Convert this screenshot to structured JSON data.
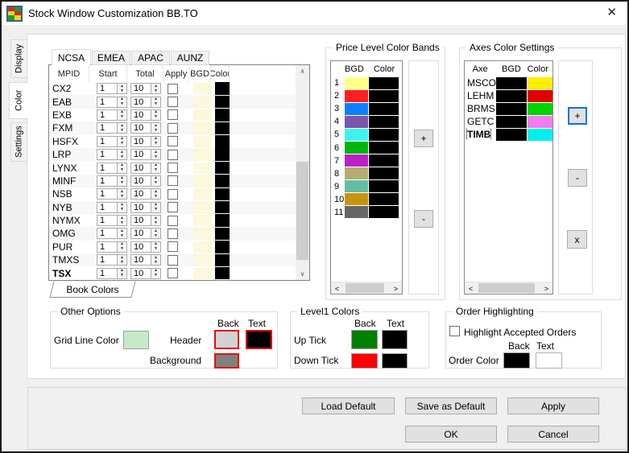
{
  "window": {
    "title": "Stock Window Customization BB.TO",
    "close_glyph": "✕"
  },
  "side_tabs": [
    {
      "label": "Display"
    },
    {
      "label": "Color"
    },
    {
      "label": "Settings"
    }
  ],
  "region_tabs": [
    {
      "label": "NCSA"
    },
    {
      "label": "EMEA"
    },
    {
      "label": "APAC"
    },
    {
      "label": "AUNZ"
    }
  ],
  "book_table": {
    "headers": {
      "mpid": "MPID",
      "start": "Start",
      "total": "Total",
      "apply": "Apply",
      "bgd": "BGD",
      "color": "Color"
    },
    "rows": [
      {
        "mpid": "CX2",
        "start": "1",
        "total": "10",
        "bgd": "#FBF8DC",
        "color": "#000000"
      },
      {
        "mpid": "EAB",
        "start": "1",
        "total": "10",
        "bgd": "#FBF8DC",
        "color": "#000000"
      },
      {
        "mpid": "EXB",
        "start": "1",
        "total": "10",
        "bgd": "#FBF8DC",
        "color": "#000000"
      },
      {
        "mpid": "FXM",
        "start": "1",
        "total": "10",
        "bgd": "#FBF8DC",
        "color": "#000000"
      },
      {
        "mpid": "HSFX",
        "start": "1",
        "total": "10",
        "bgd": "#FBF8DC",
        "color": "#000000"
      },
      {
        "mpid": "LRP",
        "start": "1",
        "total": "10",
        "bgd": "#FBF8DC",
        "color": "#000000"
      },
      {
        "mpid": "LYNX",
        "start": "1",
        "total": "10",
        "bgd": "#FBF8DC",
        "color": "#000000"
      },
      {
        "mpid": "MINF",
        "start": "1",
        "total": "10",
        "bgd": "#FBF8DC",
        "color": "#000000"
      },
      {
        "mpid": "NSB",
        "start": "1",
        "total": "10",
        "bgd": "#FBF8DC",
        "color": "#000000"
      },
      {
        "mpid": "NYB",
        "start": "1",
        "total": "10",
        "bgd": "#FBF8DC",
        "color": "#000000"
      },
      {
        "mpid": "NYMX",
        "start": "1",
        "total": "10",
        "bgd": "#FBF8DC",
        "color": "#000000"
      },
      {
        "mpid": "OMG",
        "start": "1",
        "total": "10",
        "bgd": "#FBF8DC",
        "color": "#000000"
      },
      {
        "mpid": "PUR",
        "start": "1",
        "total": "10",
        "bgd": "#FBF8DC",
        "color": "#000000"
      },
      {
        "mpid": "TMXS",
        "start": "1",
        "total": "10",
        "bgd": "#FBF8DC",
        "color": "#000000"
      },
      {
        "mpid": "TSX",
        "start": "1",
        "total": "10",
        "bgd": "#FBF8DC",
        "color": "#000000",
        "bold": true
      }
    ],
    "bottom_tab": "Book Colors"
  },
  "price_bands": {
    "title": "Price Level Color Bands",
    "headers": {
      "bgd": "BGD",
      "color": "Color"
    },
    "rows": [
      {
        "n": "1",
        "bgd": "#FFFF84",
        "color": "#000000"
      },
      {
        "n": "2",
        "bgd": "#FF1F1F",
        "color": "#000000"
      },
      {
        "n": "3",
        "bgd": "#0D7FFF",
        "color": "#000000"
      },
      {
        "n": "4",
        "bgd": "#7C55AC",
        "color": "#000000"
      },
      {
        "n": "5",
        "bgd": "#3FF2F2",
        "color": "#000000"
      },
      {
        "n": "6",
        "bgd": "#01B510",
        "color": "#000000"
      },
      {
        "n": "7",
        "bgd": "#BB22C6",
        "color": "#000000"
      },
      {
        "n": "8",
        "bgd": "#B3AD73",
        "color": "#000000"
      },
      {
        "n": "9",
        "bgd": "#62BDA3",
        "color": "#000000"
      },
      {
        "n": "10",
        "bgd": "#C6940E",
        "color": "#000000"
      },
      {
        "n": "11",
        "bgd": "#666666",
        "color": "#000000"
      }
    ],
    "add_label": "+",
    "remove_label": "-"
  },
  "axes": {
    "title": "Axes Color Settings",
    "headers": {
      "axe": "Axe",
      "bgd": "BGD",
      "color": "Color"
    },
    "rows": [
      {
        "axe": "MSCO",
        "bgd": "#000000",
        "color": "#FFEE00"
      },
      {
        "axe": "LEHM",
        "bgd": "#000000",
        "color": "#DF0000"
      },
      {
        "axe": "BRMS",
        "bgd": "#000000",
        "color": "#00D400"
      },
      {
        "axe": "GETC",
        "bgd": "#000000",
        "color": "#F07DF0"
      },
      {
        "axe": "TIMB",
        "bgd": "#000000",
        "color": "#00F0F0",
        "bold": true,
        "focused": true
      }
    ],
    "add_label": "+",
    "remove_label": "-",
    "delete_label": "x"
  },
  "other_options": {
    "title": "Other Options",
    "back_header": "Back",
    "text_header": "Text",
    "grid_line_label": "Grid Line Color",
    "grid_line_color": "#C6EAC8",
    "header_label": "Header",
    "header_back": "#D3D3D3",
    "header_text": "#000000",
    "background_label": "Background",
    "background_color": "#808080"
  },
  "level1": {
    "title": "Level1 Colors",
    "back_header": "Back",
    "text_header": "Text",
    "up_label": "Up Tick",
    "up_back": "#008000",
    "up_text": "#000000",
    "down_label": "Down Tick",
    "down_back": "#FF0000",
    "down_text": "#000000"
  },
  "order_highlighting": {
    "title": "Order Highlighting",
    "checkbox_label": "Highlight Accepted Orders",
    "checked": false,
    "back_header": "Back",
    "text_header": "Text",
    "order_color_label": "Order Color",
    "order_back": "#000000",
    "order_text": "#FFFFFF"
  },
  "action_buttons": {
    "load_default": "Load Default",
    "save_as_default": "Save as Default",
    "apply": "Apply",
    "ok": "OK",
    "cancel": "Cancel"
  },
  "glyphs": {
    "spin_up": "▲",
    "spin_down": "▼",
    "scroll_up": "∧",
    "scroll_down": "∨",
    "scroll_left": "<",
    "scroll_right": ">"
  }
}
